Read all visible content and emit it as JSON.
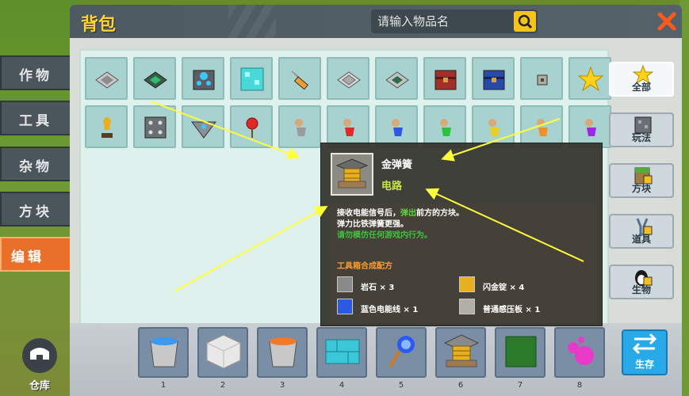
{
  "window": {
    "title": "背包",
    "search": {
      "placeholder": "请输入物品名"
    }
  },
  "side_tabs": [
    {
      "label": "作物",
      "active": false
    },
    {
      "label": "工具",
      "active": false
    },
    {
      "label": "杂物",
      "active": false
    },
    {
      "label": "方块",
      "active": false
    },
    {
      "label": "编辑",
      "active": true
    }
  ],
  "categories": [
    {
      "label": "全部",
      "icon": "star-icon",
      "active": true
    },
    {
      "label": "玩法",
      "icon": "stone-block-icon",
      "active": false
    },
    {
      "label": "方块",
      "icon": "grass-block-icon",
      "active": false
    },
    {
      "label": "道具",
      "icon": "slingshot-icon",
      "active": false
    },
    {
      "label": "生物",
      "icon": "penguin-icon",
      "active": false
    }
  ],
  "grid_items": [
    "pressure-plate-icon",
    "green-pressure-plate-icon",
    "blue-core-block-icon",
    "diamond-block-icon",
    "wrench-icon",
    "stone-pressure-plate-icon",
    "green-circuit-plate-icon",
    "red-chest-icon",
    "blue-chest-icon",
    "small-turret-icon",
    "gold-star-icon",
    "trophy-icon",
    "dice-block-icon",
    "pyramid-icon",
    "red-pin-icon",
    "gray-person-pin-icon",
    "red-person-pin-icon",
    "blue-person-pin-icon",
    "green-person-pin-icon",
    "yellow-person-pin-icon",
    "orange-person-pin-icon",
    "purple-person-pin-icon"
  ],
  "tooltip": {
    "name": "金弹簧",
    "category": "电路",
    "desc_line1_a": "接收电能信号后，",
    "desc_line1_hl": "弹出",
    "desc_line1_b": "前方的方块。",
    "desc_line2": "弹力比铁弹簧更强。",
    "desc_warn": "请勿模仿任何游戏内行为。",
    "recipe_title": "工具箱合成配方",
    "recipe": [
      {
        "name": "岩石 × 3",
        "icon": "rock-icon"
      },
      {
        "name": "闪金锭 × 4",
        "icon": "gold-ingot-icon"
      },
      {
        "name": "蓝色电能线 × 1",
        "icon": "blue-wire-icon"
      },
      {
        "name": "普通感压板 × 1",
        "icon": "pressure-plate-icon"
      }
    ]
  },
  "hotbar": [
    {
      "num": "1",
      "icon": "water-bucket-icon"
    },
    {
      "num": "2",
      "icon": "white-block-icon"
    },
    {
      "num": "3",
      "icon": "lava-bucket-icon"
    },
    {
      "num": "4",
      "icon": "ice-bricks-icon"
    },
    {
      "num": "5",
      "icon": "blue-wand-icon"
    },
    {
      "num": "6",
      "icon": "gold-spring-icon"
    },
    {
      "num": "7",
      "icon": "green-block-icon"
    },
    {
      "num": "8",
      "icon": "pink-slime-icon"
    }
  ],
  "store_label": "生存",
  "warehouse_label": "仓库",
  "colors": {
    "accent": "#ffd23a",
    "active_tab": "#e8702a",
    "tooltip_green": "#c4e64a",
    "arrow": "#ffff3a"
  }
}
